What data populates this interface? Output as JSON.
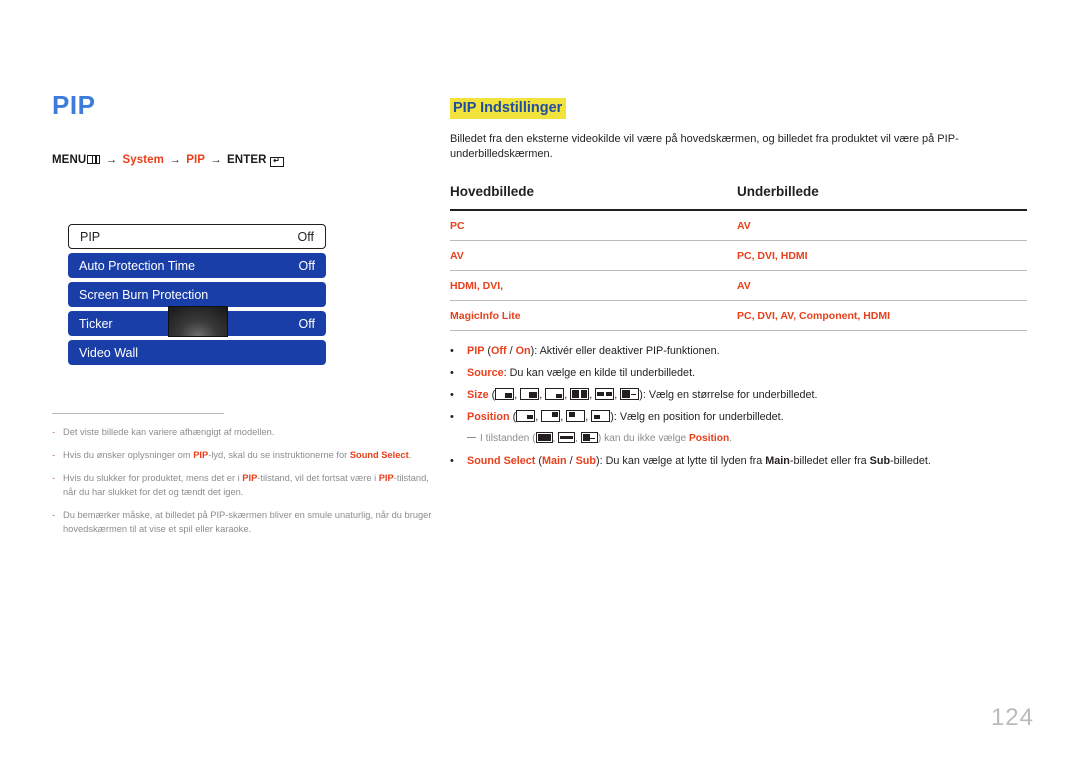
{
  "page": {
    "title": "PIP",
    "number": "124"
  },
  "menu_path": {
    "menu_label": "MENU",
    "menu_icon": "menu-bars-icon",
    "arrow": "→",
    "step1": "System",
    "step2": "PIP",
    "enter_label": "ENTER",
    "enter_icon": "enter-key-icon"
  },
  "osd_menu": {
    "rows": [
      {
        "label": "PIP",
        "value": "Off",
        "state": "selected"
      },
      {
        "label": "Auto Protection Time",
        "value": "Off",
        "state": "blue"
      },
      {
        "label": "Screen Burn Protection",
        "value": "",
        "state": "blue"
      },
      {
        "label": "Ticker",
        "value": "Off",
        "state": "blue",
        "thumbnail": "dark-screen-thumbnail"
      },
      {
        "label": "Video Wall",
        "value": "",
        "state": "blue"
      }
    ]
  },
  "notes": [
    {
      "marker": "-",
      "parts": [
        {
          "t": "Det viste billede kan variere afhængigt af modellen.",
          "b": false
        }
      ]
    },
    {
      "marker": "-",
      "parts": [
        {
          "t": "Hvis du ønsker oplysninger om ",
          "b": false
        },
        {
          "t": "PIP",
          "b": true
        },
        {
          "t": "-lyd, skal du se instruktionerne for ",
          "b": false
        },
        {
          "t": "Sound Select",
          "b": true
        },
        {
          "t": ".",
          "b": false
        }
      ]
    },
    {
      "marker": "-",
      "parts": [
        {
          "t": "Hvis du slukker for produktet, mens det er i ",
          "b": false
        },
        {
          "t": "PIP",
          "b": true
        },
        {
          "t": "-tilstand, vil det fortsat være i ",
          "b": false
        },
        {
          "t": "PIP",
          "b": true
        },
        {
          "t": "-tilstand, når du har slukket for det og tændt det igen.",
          "b": false
        }
      ]
    },
    {
      "marker": "-",
      "parts": [
        {
          "t": "Du bemærker måske, at billedet på PIP-skærmen bliver en smule unaturlig, når du bruger hovedskærmen til at vise et spil eller karaoke.",
          "b": false
        }
      ]
    }
  ],
  "section": {
    "heading": "PIP Indstillinger",
    "intro": "Billedet fra den eksterne videokilde vil være på hovedskærmen, og billedet fra produktet vil være på PIP-underbilledskærmen."
  },
  "table": {
    "headers": [
      "Hovedbillede",
      "Underbillede"
    ],
    "rows": [
      {
        "main": "PC",
        "sub": "AV"
      },
      {
        "main": "AV",
        "sub": "PC, DVI, HDMI"
      },
      {
        "main": "HDMI, DVI,",
        "sub": "AV"
      },
      {
        "main": "MagicInfo Lite",
        "sub": "PC, DVI, AV, Component, HDMI"
      }
    ]
  },
  "bullets": {
    "pip": {
      "key": "PIP",
      "options_open": " (",
      "opt1": "Off",
      "sep": " / ",
      "opt2": "On",
      "options_close": "): ",
      "desc": "Aktivér eller deaktiver PIP-funktionen."
    },
    "source": {
      "key": "Source",
      "colon": ": ",
      "desc": "Du kan vælge en kilde til underbilledet."
    },
    "size": {
      "key": "Size",
      "open": " (",
      "close": "): ",
      "desc": "Vælg en størrelse for underbilledet.",
      "icons": [
        "size-small-br",
        "size-medium-br",
        "size-tiny-br",
        "size-split-half",
        "size-split-half-inset",
        "size-split-wide"
      ]
    },
    "position": {
      "key": "Position",
      "open": " (",
      "close": "): ",
      "desc": "Vælg en position for underbilledet.",
      "icons": [
        "position-bottom-right",
        "position-top-right",
        "position-top-left",
        "position-bottom-left"
      ]
    },
    "subnote": {
      "pre": "I tilstanden (",
      "mid": ") kan du ikke vælge ",
      "key": "Position",
      "end": ".",
      "icons": [
        "size-split-half",
        "size-split-half-inset",
        "size-split-wide"
      ]
    },
    "sound_select": {
      "key": "Sound Select",
      "open": " (",
      "opt1": "Main",
      "sep": " / ",
      "opt2": "Sub",
      "close": "): ",
      "desc_1": "Du kan vælge at lytte til lyden fra ",
      "k1": "Main",
      "desc_2": "-billedet eller fra ",
      "k2": "Sub",
      "desc_3": "-billedet."
    }
  },
  "colors": {
    "title_blue": "#3b7dd8",
    "accent_red": "#e8401c",
    "menu_blue": "#1a3ea8",
    "highlight_yellow": "#f2e23c",
    "heading_blue": "#1f4ea1",
    "muted_gray": "#8a8d90"
  }
}
